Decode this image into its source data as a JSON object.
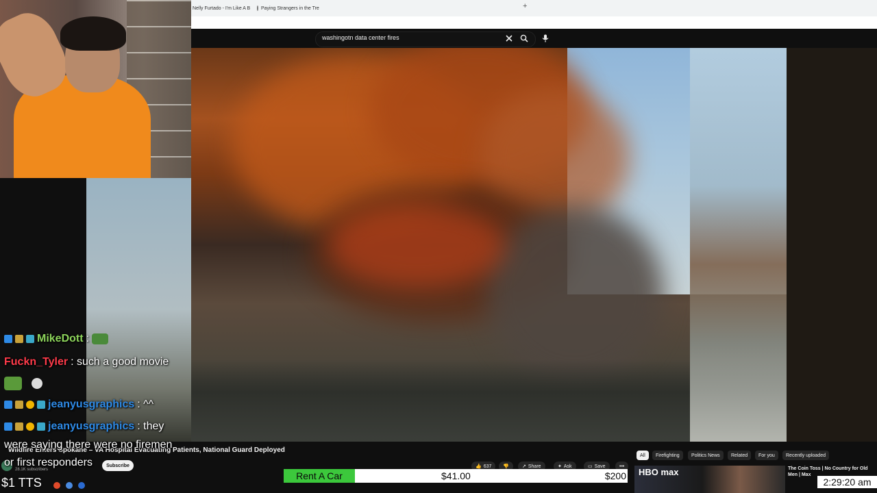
{
  "browser": {
    "tabs": [
      {
        "label": "Nelly Furtado - I'm Like A B"
      },
      {
        "label": "Paying Strangers in the Tre"
      }
    ],
    "new_tab": "+"
  },
  "youtube": {
    "search": {
      "value": "washingotn data center fires"
    },
    "video": {
      "title": "Wildfire Enters Spokane – VA Hospital Evacuating Patients, National Guard Deployed",
      "subscribers": "28.1K subscribers",
      "subscribe_label": "Subscribe",
      "likes": "637",
      "share_label": "Share",
      "ask_label": "Ask",
      "save_label": "Save",
      "more_label": "•••"
    },
    "chips": [
      "All",
      "Firefighting",
      "Politics News",
      "Related",
      "For you",
      "Recently uploaded"
    ],
    "recommended": {
      "title": "The Coin Toss | No Country for Old Men | Max",
      "brand": "HBO max"
    }
  },
  "chat": [
    {
      "user": "MikeDott",
      "message": ":",
      "color": "#8dd45b"
    },
    {
      "user": "Fuckn_Tyler",
      "message": ": such a good movie",
      "color": "#ff3b4a"
    },
    {
      "user": "jeanyusgraphics",
      "message": ": ^^",
      "color": "#2e8ae6"
    },
    {
      "user": "jeanyusgraphics",
      "message": ": they",
      "color": "#2e8ae6"
    }
  ],
  "chat_continuation": [
    "were saying there were no firemen",
    "or first responders"
  ],
  "overlay": {
    "ticker_label": "Rent A Car",
    "ticker_price": "$41.00",
    "ticker_goal": "$200",
    "clock": "2:29:20 am",
    "tts": "$1 TTS"
  }
}
